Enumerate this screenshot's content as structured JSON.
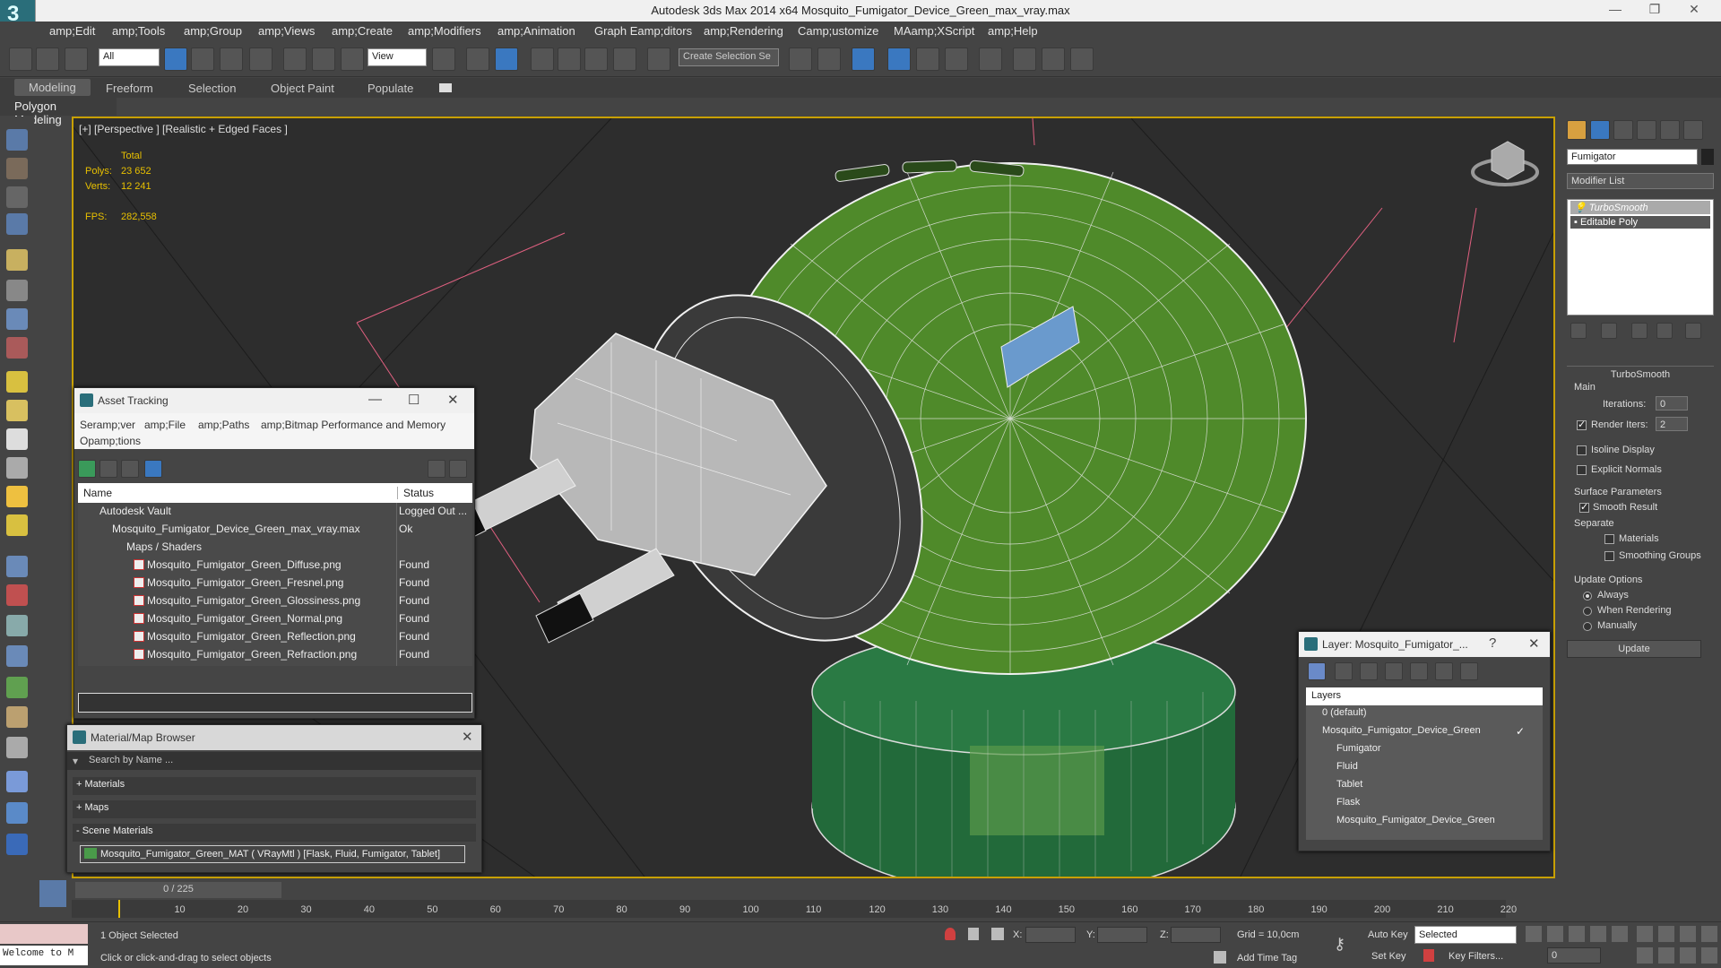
{
  "window": {
    "title": "Autodesk 3ds Max  2014 x64     Mosquito_Fumigator_Device_Green_max_vray.max",
    "min": "—",
    "max": "❐",
    "close": "✕"
  },
  "menu": [
    "amp;Edit",
    "amp;Tools",
    "amp;Group",
    "amp;Views",
    "amp;Create",
    "amp;Modifiers",
    "amp;Animation",
    "Graph Eamp;ditors",
    "amp;Rendering",
    "Camp;ustomize",
    "MAamp;XScript",
    "amp;Help"
  ],
  "toolbar": {
    "filter_select": "All",
    "ref_coord_select": "View",
    "selection_set": "Create Selection Se"
  },
  "ribbon": {
    "tabs": [
      "Modeling",
      "Freeform",
      "Selection",
      "Object Paint",
      "Populate"
    ],
    "panel": "Polygon Modeling"
  },
  "viewport": {
    "label": "[+] [Perspective ] [Realistic + Edged Faces ]",
    "stats": {
      "total_label": "Total",
      "polys_label": "Polys:",
      "polys": "23 652",
      "verts_label": "Verts:",
      "verts": "12 241",
      "fps_label": "FPS:",
      "fps": "282,558"
    }
  },
  "asset_tracking": {
    "title": "Asset Tracking",
    "menu": [
      "Seramp;ver",
      "amp;File",
      "amp;Paths",
      "amp;Bitmap Performance and Memory",
      "Opamp;tions"
    ],
    "columns": [
      "Name",
      "Status"
    ],
    "rows": [
      {
        "name": "Autodesk Vault",
        "status": "Logged Out ..."
      },
      {
        "name": "Mosquito_Fumigator_Device_Green_max_vray.max",
        "status": "Ok"
      },
      {
        "name": "Maps / Shaders",
        "status": ""
      },
      {
        "name": "Mosquito_Fumigator_Green_Diffuse.png",
        "status": "Found"
      },
      {
        "name": "Mosquito_Fumigator_Green_Fresnel.png",
        "status": "Found"
      },
      {
        "name": "Mosquito_Fumigator_Green_Glossiness.png",
        "status": "Found"
      },
      {
        "name": "Mosquito_Fumigator_Green_Normal.png",
        "status": "Found"
      },
      {
        "name": "Mosquito_Fumigator_Green_Reflection.png",
        "status": "Found"
      },
      {
        "name": "Mosquito_Fumigator_Green_Refraction.png",
        "status": "Found"
      }
    ]
  },
  "material_browser": {
    "title": "Material/Map Browser",
    "search_placeholder": "Search by Name ...",
    "groups": [
      "+ Materials",
      "+ Maps",
      "- Scene Materials"
    ],
    "item": "Mosquito_Fumigator_Green_MAT  ( VRayMtl )  [Flask, Fluid, Fumigator, Tablet]"
  },
  "layer_window": {
    "title": "Layer: Mosquito_Fumigator_...",
    "help": "?",
    "header": "Layers",
    "items": [
      "0 (default)",
      "Mosquito_Fumigator_Device_Green",
      "Fumigator",
      "Fluid",
      "Tablet",
      "Flask",
      "Mosquito_Fumigator_Device_Green"
    ]
  },
  "command_panel": {
    "object_name": "Fumigator",
    "modifier_list": "Modifier List",
    "stack": [
      "TurboSmooth",
      "Editable Poly"
    ],
    "rollout": "TurboSmooth",
    "main": "Main",
    "iterations_label": "Iterations:",
    "iterations": "0",
    "render_iters_label": "Render Iters:",
    "render_iters": "2",
    "isoline": "Isoline Display",
    "explicit": "Explicit Normals",
    "surface": "Surface Parameters",
    "smooth_result": "Smooth Result",
    "separate": "Separate",
    "materials": "Materials",
    "smoothing_groups": "Smoothing Groups",
    "update_options": "Update Options",
    "always": "Always",
    "when_rendering": "When Rendering",
    "manually": "Manually",
    "update_btn": "Update"
  },
  "timeline": {
    "frame": "0 / 225",
    "ticks": [
      "10",
      "20",
      "30",
      "40",
      "50",
      "60",
      "70",
      "80",
      "90",
      "100",
      "110",
      "120",
      "130",
      "140",
      "150",
      "160",
      "170",
      "180",
      "190",
      "200",
      "210",
      "220"
    ]
  },
  "status": {
    "welcome": "Welcome to M",
    "selected": "1 Object Selected",
    "prompt": "Click or click-and-drag to select objects",
    "x_label": "X:",
    "y_label": "Y:",
    "z_label": "Z:",
    "grid": "Grid = 10,0cm",
    "auto_key": "Auto Key",
    "set_key": "Set Key",
    "key_mode": "Selected",
    "key_filters": "Key Filters...",
    "add_time_tag": "Add Time Tag",
    "frame_field": "0"
  }
}
